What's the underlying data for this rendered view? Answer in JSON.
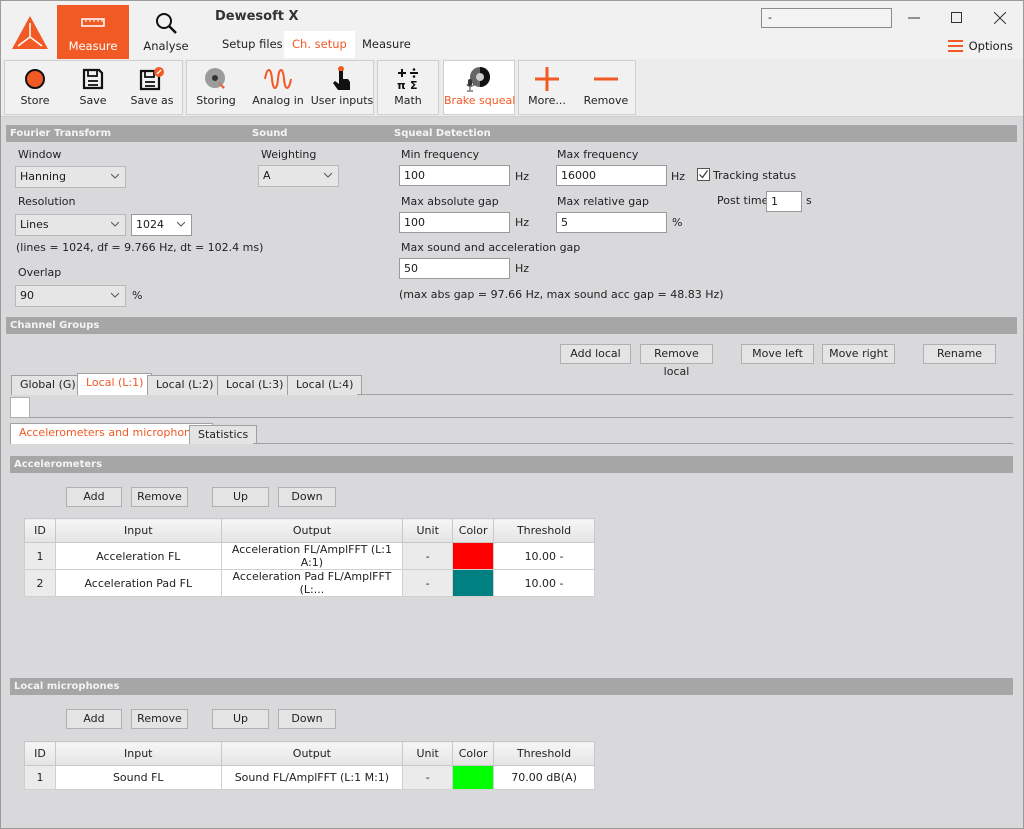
{
  "app": {
    "title": "Dewesoft X",
    "title_input_value": "-",
    "nav": [
      {
        "label": "Measure",
        "icon": "ruler-icon",
        "active": true
      },
      {
        "label": "Analyse",
        "icon": "magnifier-icon",
        "active": false
      }
    ],
    "subtabs": [
      {
        "label": "Setup files",
        "active": false
      },
      {
        "label": "Ch. setup",
        "active": true
      },
      {
        "label": "Measure",
        "active": false
      }
    ],
    "options_label": "Options",
    "accent_color": "#f15a24"
  },
  "toolbar": {
    "store": "Store",
    "save": "Save",
    "save_as": "Save as",
    "storing": "Storing",
    "analog_in": "Analog in",
    "user_inputs": "User inputs",
    "math": "Math",
    "brake_squeal": "Brake squeal",
    "more": "More...",
    "remove": "Remove"
  },
  "fourier": {
    "header": "Fourier Transform",
    "window_label": "Window",
    "window_value": "Hanning",
    "resolution_label": "Resolution",
    "resolution_mode": "Lines",
    "resolution_value": "1024",
    "info": "(lines = 1024, df = 9.766 Hz, dt = 102.4 ms)",
    "overlap_label": "Overlap",
    "overlap_value": "90",
    "overlap_unit": "%"
  },
  "sound": {
    "header": "Sound",
    "weighting_label": "Weighting",
    "weighting_value": "A"
  },
  "squeal": {
    "header": "Squeal Detection",
    "min_freq_label": "Min frequency",
    "min_freq_value": "100",
    "min_freq_unit": "Hz",
    "max_freq_label": "Max frequency",
    "max_freq_value": "16000",
    "max_freq_unit": "Hz",
    "tracking_label": "Tracking status",
    "tracking_checked": true,
    "post_time_label": "Post time",
    "post_time_value": "1",
    "post_time_unit": "s",
    "max_abs_gap_label": "Max absolute gap",
    "max_abs_gap_value": "100",
    "max_abs_gap_unit": "Hz",
    "max_rel_gap_label": "Max relative gap",
    "max_rel_gap_value": "5",
    "max_rel_gap_unit": "%",
    "max_sa_gap_label": "Max sound and acceleration gap",
    "max_sa_gap_value": "50",
    "max_sa_gap_unit": "Hz",
    "info": "(max abs gap = 97.66 Hz, max sound acc gap = 48.83 Hz)"
  },
  "channel_groups": {
    "header": "Channel Groups",
    "buttons": {
      "add_local": "Add local",
      "remove_local": "Remove local",
      "move_left": "Move left",
      "move_right": "Move right",
      "rename": "Rename"
    },
    "tabs": [
      {
        "label": "Global (G)",
        "active": false
      },
      {
        "label": "Local (L:1)",
        "active": true
      },
      {
        "label": "Local (L:2)",
        "active": false
      },
      {
        "label": "Local (L:3)",
        "active": false
      },
      {
        "label": "Local (L:4)",
        "active": false
      }
    ],
    "subtabs": [
      {
        "label": "Accelerometers and microphones",
        "active": true
      },
      {
        "label": "Statistics",
        "active": false
      }
    ]
  },
  "accelerometers": {
    "header": "Accelerometers",
    "buttons": {
      "add": "Add",
      "remove": "Remove",
      "up": "Up",
      "down": "Down"
    },
    "columns": [
      "ID",
      "Input",
      "Output",
      "Unit",
      "Color",
      "Threshold"
    ],
    "rows": [
      {
        "id": "1",
        "input": "Acceleration FL",
        "output": "Acceleration FL/AmplFFT (L:1 A:1)",
        "unit": "-",
        "color": "#ff0000",
        "threshold": "10.00 -"
      },
      {
        "id": "2",
        "input": "Acceleration Pad FL",
        "output": "Acceleration Pad FL/AmplFFT (L:...",
        "unit": "-",
        "color": "#008080",
        "threshold": "10.00 -"
      }
    ]
  },
  "microphones": {
    "header": "Local microphones",
    "buttons": {
      "add": "Add",
      "remove": "Remove",
      "up": "Up",
      "down": "Down"
    },
    "columns": [
      "ID",
      "Input",
      "Output",
      "Unit",
      "Color",
      "Threshold"
    ],
    "rows": [
      {
        "id": "1",
        "input": "Sound FL",
        "output": "Sound FL/AmplFFT (L:1 M:1)",
        "unit": "-",
        "color": "#00ff00",
        "threshold": "70.00 dB(A)"
      }
    ]
  }
}
